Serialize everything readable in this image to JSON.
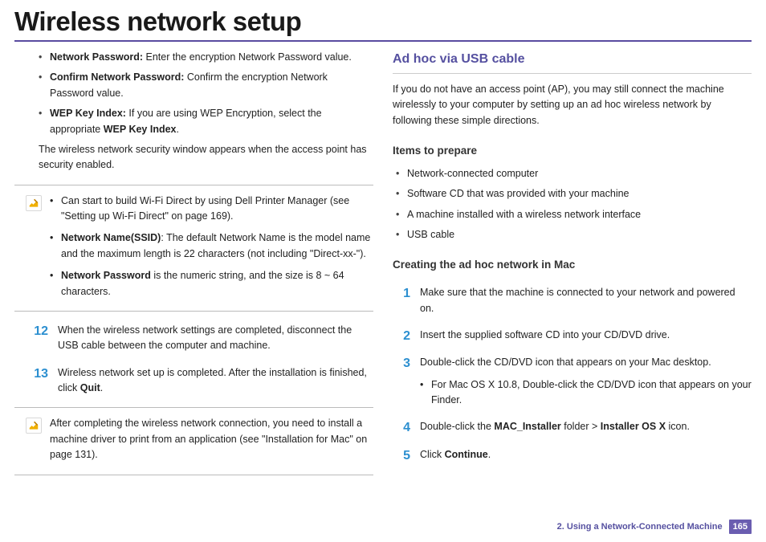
{
  "header": {
    "title": "Wireless network setup"
  },
  "left": {
    "bullets": [
      {
        "label": "Network Password:",
        "text": " Enter the encryption Network Password value."
      },
      {
        "label": "Confirm Network Password:",
        "text": " Confirm the encryption Network Password value."
      },
      {
        "label": "WEP Key Index:",
        "text": " If you are using WEP Encryption, select the appropriate ",
        "label2": "WEP Key Index",
        "tail": "."
      }
    ],
    "para1": "The wireless network security window appears when the access point has security enabled.",
    "note1": {
      "b0a": "Can start to build Wi-Fi Direct by using ",
      "b0mid": "Dell Printer Manager",
      "b0b": " (see \"Setting up Wi-Fi Direct\" on page 169).",
      "b1label": "Network Name(SSID)",
      "b1text": ": The default Network Name is the model name and the maximum length is 22 characters (not including \"Direct-xx-\").",
      "b2label": "Network Password",
      "b2text": " is the numeric string, and the size is 8 ~ 64 characters."
    },
    "steps": [
      {
        "num": "12",
        "body": "When the wireless network settings are completed, disconnect the USB cable between the computer and machine."
      },
      {
        "num": "13",
        "body_a": "Wireless network set up is completed. After the installation is finished, click ",
        "body_bold": "Quit",
        "body_b": "."
      }
    ],
    "note2": "After completing the wireless network connection, you need to install a machine driver to print from an application (see \"Installation for Mac\" on page 131)."
  },
  "right": {
    "h3": "Ad hoc via USB cable",
    "intro": "If you do not have an access point (AP), you may still connect the machine wirelessly to your computer by setting up an ad hoc wireless network by following these simple directions.",
    "items_h": "Items to prepare",
    "items": [
      "Network-connected computer",
      "Software CD that was provided with your machine",
      "A machine installed with a wireless network interface",
      "USB cable"
    ],
    "create_h": "Creating the ad hoc network in Mac",
    "steps": [
      {
        "num": "1",
        "body": "Make sure that the machine is connected to your network and powered on."
      },
      {
        "num": "2",
        "body": "Insert the supplied software CD into your CD/DVD drive."
      },
      {
        "num": "3",
        "body": "Double-click the CD/DVD icon that appears on your Mac desktop.",
        "sub": "For Mac OS X 10.8, Double-click the CD/DVD icon that appears on your Finder."
      },
      {
        "num": "4",
        "body_a": "Double-click the ",
        "body_bold1": "MAC_Installer",
        "body_mid": " folder > ",
        "body_bold2": "Installer OS X",
        "body_b": " icon."
      },
      {
        "num": "5",
        "body_a": "Click ",
        "body_bold1": "Continue",
        "body_b": "."
      }
    ]
  },
  "footer": {
    "chapter": "2.  Using a Network-Connected Machine",
    "page": "165"
  }
}
